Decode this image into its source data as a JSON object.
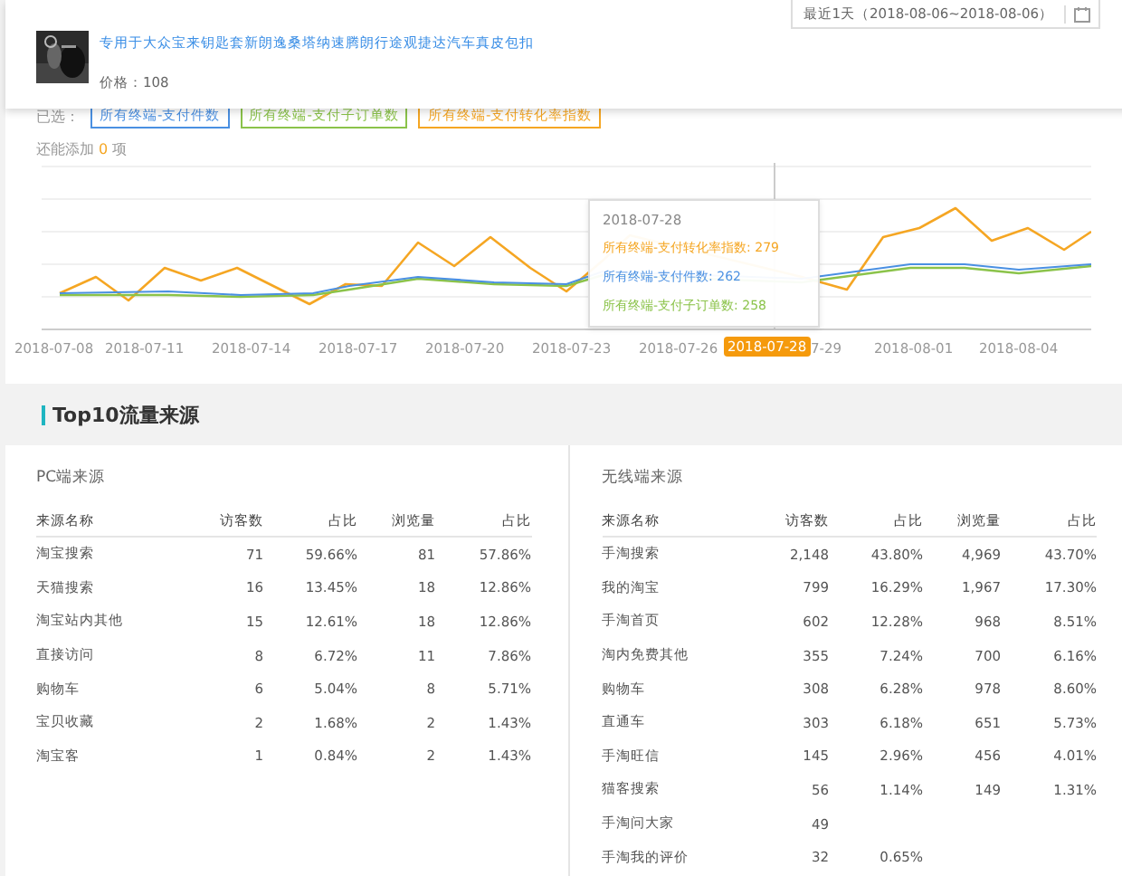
{
  "date_range": {
    "label": "最近1天（2018-08-06~2018-08-06）"
  },
  "product": {
    "title": "专用于大众宝来钥匙套新朗逸桑塔纳速腾朗行途观捷达汽车真皮包扣",
    "price": "价格：108"
  },
  "selected": {
    "label": "已选：",
    "tags": [
      {
        "label": "所有终端-支付件数",
        "color": "#4a90e2"
      },
      {
        "label": "所有终端-支付子订单数",
        "color": "#8bc34a"
      },
      {
        "label": "所有终端-支付转化率指数",
        "color": "#f5a623"
      }
    ]
  },
  "add_hint": {
    "prefix": "还能添加",
    "count": "0",
    "suffix": "项"
  },
  "chart": {
    "x_labels": [
      "2018-07-08",
      "2018-07-11",
      "2018-07-14",
      "2018-07-17",
      "2018-07-20",
      "2018-07-23",
      "2018-07-26",
      "7-29",
      "2018-08-01",
      "2018-08-04"
    ],
    "pointer_label": "2018-07-28",
    "tooltip": {
      "date": "2018-07-28",
      "rows": [
        {
          "label": "所有终端-支付转化率指数: 279",
          "color": "#f5a623"
        },
        {
          "label": "所有终端-支付件数: 262",
          "color": "#4a90e2"
        },
        {
          "label": "所有终端-支付子订单数: 258",
          "color": "#8bc34a"
        }
      ]
    }
  },
  "section": {
    "title": "Top10流量来源"
  },
  "panels": [
    {
      "title": "PC端来源",
      "columns": [
        "来源名称",
        "访客数",
        "占比",
        "浏览量",
        "占比"
      ],
      "rows": [
        [
          "淘宝搜索",
          "71",
          "59.66%",
          "81",
          "57.86%"
        ],
        [
          "天猫搜索",
          "16",
          "13.45%",
          "18",
          "12.86%"
        ],
        [
          "淘宝站内其他",
          "15",
          "12.61%",
          "18",
          "12.86%"
        ],
        [
          "直接访问",
          "8",
          "6.72%",
          "11",
          "7.86%"
        ],
        [
          "购物车",
          "6",
          "5.04%",
          "8",
          "5.71%"
        ],
        [
          "宝贝收藏",
          "2",
          "1.68%",
          "2",
          "1.43%"
        ],
        [
          "淘宝客",
          "1",
          "0.84%",
          "2",
          "1.43%"
        ]
      ]
    },
    {
      "title": "无线端来源",
      "columns": [
        "来源名称",
        "访客数",
        "占比",
        "浏览量",
        "占比"
      ],
      "rows": [
        [
          "手淘搜索",
          "2,148",
          "43.80%",
          "4,969",
          "43.70%"
        ],
        [
          "我的淘宝",
          "799",
          "16.29%",
          "1,967",
          "17.30%"
        ],
        [
          "手淘首页",
          "602",
          "12.28%",
          "968",
          "8.51%"
        ],
        [
          "淘内免费其他",
          "355",
          "7.24%",
          "700",
          "6.16%"
        ],
        [
          "购物车",
          "308",
          "6.28%",
          "978",
          "8.60%"
        ],
        [
          "直通车",
          "303",
          "6.18%",
          "651",
          "5.73%"
        ],
        [
          "手淘旺信",
          "145",
          "2.96%",
          "456",
          "4.01%"
        ],
        [
          "猫客搜索",
          "56",
          "1.14%",
          "149",
          "1.31%"
        ],
        [
          "手淘问大家",
          "49"
        ],
        [
          "手淘我的评价",
          "32",
          "0.65%"
        ]
      ]
    }
  ]
}
